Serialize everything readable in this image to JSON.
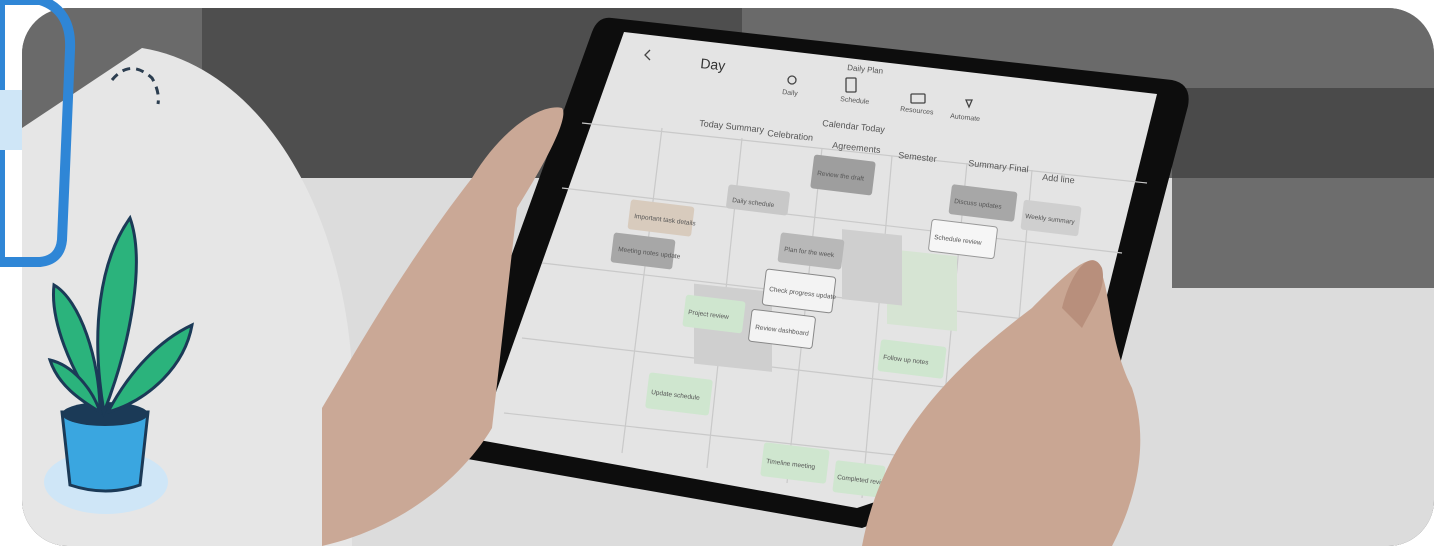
{
  "app": {
    "header_title": "Day",
    "top_label": "Daily Plan",
    "toolbar": [
      {
        "label": "Daily",
        "icon": "lightbulb-icon"
      },
      {
        "label": "Schedule",
        "icon": "tablet-icon"
      },
      {
        "label": "Resources",
        "icon": "folder-icon"
      },
      {
        "label": "Automate",
        "icon": "sparkle-icon"
      }
    ],
    "column_headers": [
      "Today Summary",
      "Celebration",
      "Agreements",
      "Semester",
      "Summary Final",
      "Add line"
    ],
    "subheader": "Calendar Today",
    "cards": [
      "Important task details",
      "Meeting notes update",
      "Daily schedule",
      "Review the draft",
      "Plan for the week",
      "Check progress update",
      "Project review",
      "Review dashboard",
      "Discuss updates",
      "Schedule review",
      "Weekly summary",
      "Follow up notes",
      "Update schedule",
      "Timeline meeting",
      "Completed review"
    ]
  },
  "colors": {
    "accent_blue": "#2f86d6",
    "plant_green": "#2bb37c",
    "pot_blue": "#3aa6e0",
    "card_green": "#cfe6cf",
    "card_grey": "#bdbdbd"
  }
}
